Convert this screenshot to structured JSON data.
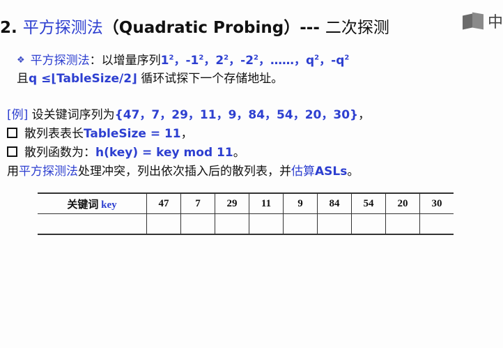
{
  "title": {
    "number": "2.",
    "cn": "平方探测法",
    "en": "（Quadratic Probing）---",
    "cn2": "二次探测"
  },
  "logo": {
    "text": "中"
  },
  "rule": {
    "label": "平方探测法",
    "text1": "：以增量序列",
    "seq": [
      "1",
      "-1",
      "2",
      "-2",
      "……",
      "q",
      "-q"
    ],
    "line2_prefix": "且",
    "line2_cond": "q ≤⌊TableSize/2⌋",
    "line2_suffix": "循环试探下一个存储地址。"
  },
  "example": {
    "tag": "[例]",
    "text": "设关键词序列为",
    "keys_text": "{47，7，29，11，9，84，54，20，30}",
    "end": "，",
    "item1_cn": "散列表表长",
    "item1_en": "TableSize = 11",
    "item1_end": "，",
    "item2_cn": "散列函数为：",
    "item2_en": "h(key) = key mod 11",
    "item2_end": "。",
    "line6_a": "用",
    "line6_b": "平方探测法",
    "line6_c": "处理冲突，列出依次插入后的散列表，并",
    "line6_d": "估算",
    "line6_e": "ASLs",
    "line6_f": "。"
  },
  "table": {
    "header_cn": "关键词",
    "header_en": "key",
    "keys": [
      "47",
      "7",
      "29",
      "11",
      "9",
      "84",
      "54",
      "20",
      "30"
    ]
  }
}
